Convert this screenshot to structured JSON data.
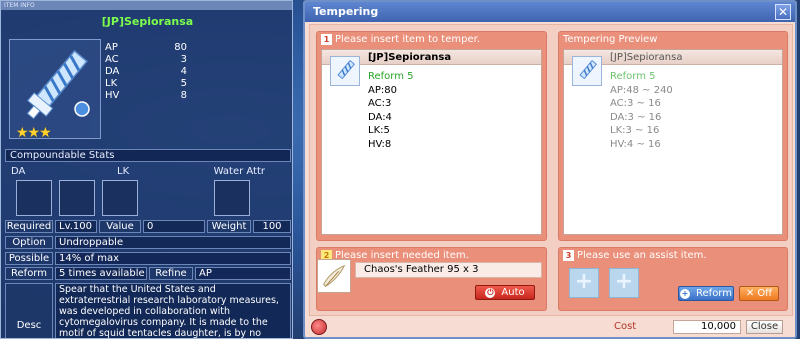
{
  "info": {
    "titlebar": "ITEM INFO",
    "item_name": "[JP]Sepioransa",
    "stars": "★★★",
    "stats": [
      {
        "k": "AP",
        "v": "80"
      },
      {
        "k": "AC",
        "v": "3"
      },
      {
        "k": "DA",
        "v": "4"
      },
      {
        "k": "LK",
        "v": "5"
      },
      {
        "k": "HV",
        "v": "8"
      }
    ],
    "compoundable": "Compoundable Stats",
    "attr_da": "DA",
    "attr_lk": "LK",
    "attr_water": "Water Attr",
    "required_label": "Required",
    "required_value": "Lv.100",
    "value_label": "Value",
    "value_value": "0",
    "weight_label": "Weight",
    "weight_value": "100",
    "option_label": "Option",
    "option_value": "Undroppable",
    "possible_label": "Possible",
    "possible_value": "14% of max",
    "reform_label": "Reform",
    "reform_value": "5 times available",
    "refine_label": "Refine",
    "refine_value": "AP",
    "desc_label": "Desc",
    "desc_text": "Spear that the United States and extraterrestrial research laboratory measures, was developed in collaboration with cytomegalovirus company. It is made to the motif of squid tentacles daughter, is by no means inferior to the other in both speed"
  },
  "tempering": {
    "title": "Tempering",
    "close_icon": "✕",
    "step1": "Please insert item to temper.",
    "step1_num": "1",
    "preview_label": "Tempering Preview",
    "item": {
      "name": "[JP]Sepioransa",
      "reform": "Reform 5",
      "lines": [
        "AP:80",
        "AC:3",
        "DA:4",
        "LK:5",
        "HV:8"
      ]
    },
    "preview": {
      "name": "[JP]Sepioransa",
      "reform": "Reform 5",
      "lines": [
        "AP:48 ~ 240",
        "AC:3 ~ 16",
        "DA:3 ~ 16",
        "LK:3 ~ 16",
        "HV:4 ~ 16"
      ]
    },
    "step2_num": "2",
    "step2": "Please insert needed item.",
    "feather": "Chaos's Feather 95 x 3",
    "auto_label": "Auto",
    "step3_num": "3",
    "step3": "Please use an assist item.",
    "reform_btn": "Reform",
    "off_btn": "Off",
    "cost_label": "Cost",
    "cost_value": "10,000",
    "close_btn": "Close"
  },
  "colors": {
    "accent_blue": "#3e64b1",
    "reform_green": "#2aa52a",
    "panel_salmon": "#ea8f7a",
    "name_green": "#7cff4c"
  }
}
